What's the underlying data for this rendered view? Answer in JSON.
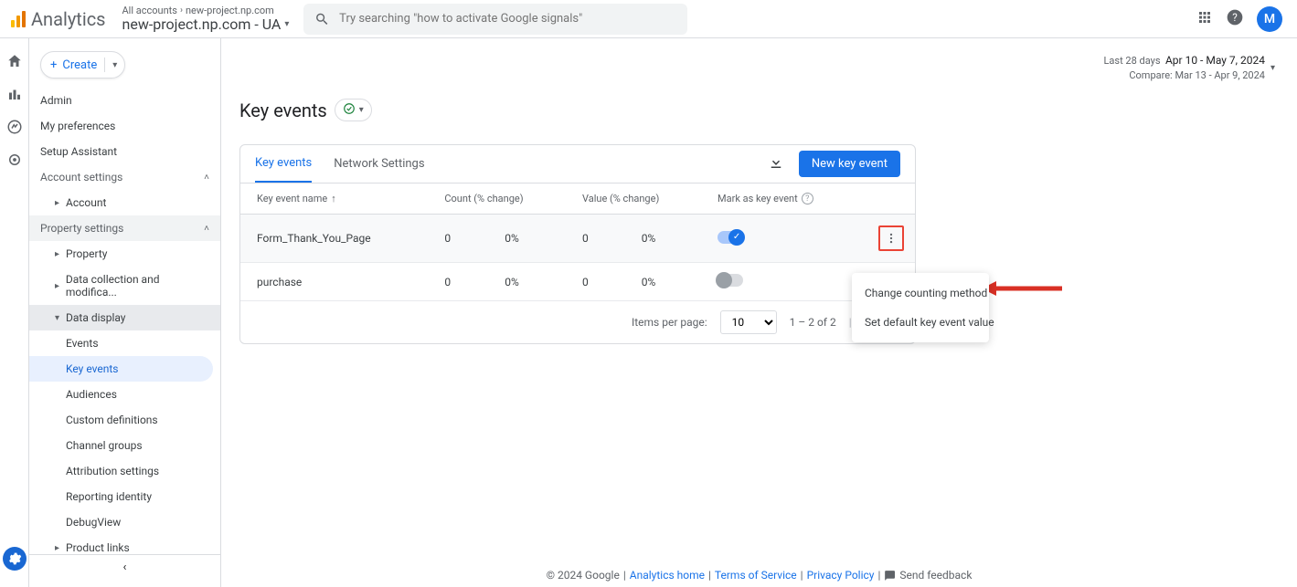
{
  "brand": "Analytics",
  "breadcrumb_all": "All accounts",
  "breadcrumb_acct": "new-project.np.com",
  "property_name": "new-project.np.com - UA",
  "search_placeholder": "Try searching \"how to activate Google signals\"",
  "avatar_letter": "M",
  "create_label": "Create",
  "sidebar": {
    "items": [
      "Admin",
      "My preferences",
      "Setup Assistant"
    ],
    "account_settings": "Account settings",
    "account": "Account",
    "property_settings": "Property settings",
    "property": "Property",
    "data_collection": "Data collection and modifica...",
    "data_display": "Data display",
    "subsubs": [
      "Events",
      "Key events",
      "Audiences",
      "Custom definitions",
      "Channel groups",
      "Attribution settings",
      "Reporting identity",
      "DebugView"
    ],
    "product_links": "Product links"
  },
  "date": {
    "label": "Last 28 days",
    "range": "Apr 10 - May 7, 2024",
    "compare": "Compare: Mar 13 - Apr 9, 2024"
  },
  "page_title": "Key events",
  "tabs": {
    "key_events": "Key events",
    "network": "Network Settings"
  },
  "new_button": "New key event",
  "columns": {
    "name": "Key event name",
    "count": "Count (% change)",
    "value": "Value (% change)",
    "mark": "Mark as key event"
  },
  "rows": [
    {
      "name": "Form_Thank_You_Page",
      "count_n": "0",
      "count_p": "0%",
      "val_n": "0",
      "val_p": "0%",
      "on": true
    },
    {
      "name": "purchase",
      "count_n": "0",
      "count_p": "0%",
      "val_n": "0",
      "val_p": "0%",
      "on": false
    }
  ],
  "pager": {
    "items_label": "Items per page:",
    "page_size": "10",
    "range": "1 – 2 of 2"
  },
  "menu": {
    "change": "Change counting method",
    "default": "Set default key event value"
  },
  "footer": {
    "copyright": "© 2024 Google",
    "home": "Analytics home",
    "terms": "Terms of Service",
    "privacy": "Privacy Policy",
    "feedback": "Send feedback"
  }
}
